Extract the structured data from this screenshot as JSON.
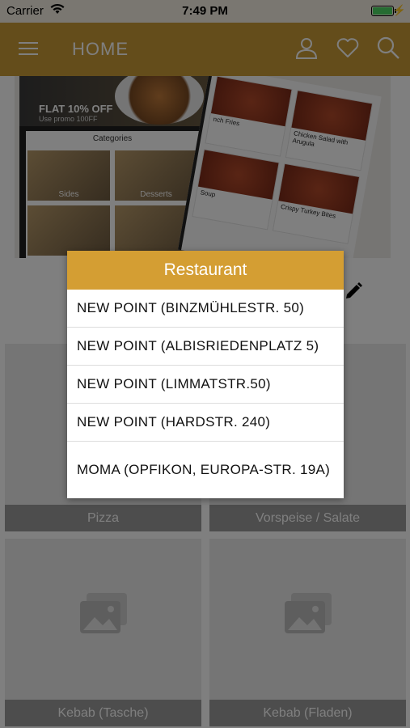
{
  "status_bar": {
    "carrier": "Carrier",
    "time": "7:49 PM"
  },
  "nav": {
    "title": "HOME"
  },
  "banner": {
    "promo_text": "FLAT 10% OFF",
    "promo_code": "Use promo 100FF",
    "categories_title": "Categories",
    "category_labels": [
      "Sides",
      "Desserts",
      "",
      ""
    ],
    "menu_items": [
      "nch Fries",
      "Chicken Salad with Arugula",
      "Soup",
      "Crispy Turkey Bites"
    ]
  },
  "categories": [
    {
      "label": "Pizza"
    },
    {
      "label": "Vorspeise / Salate"
    },
    {
      "label": "Kebab (Tasche)"
    },
    {
      "label": "Kebab (Fladen)"
    }
  ],
  "dialog": {
    "title": "Restaurant",
    "options": [
      "NEW POINT (BINZMÜHLESTR. 50)",
      "NEW POINT (ALBISRIEDENPLATZ 5)",
      "NEW POINT (LIMMATSTR.50)",
      "NEW POINT (HARDSTR. 240)",
      "MOMA (OPFIKON, EUROPA-STR. 19A)"
    ]
  },
  "colors": {
    "accent": "#d49e33",
    "navbar": "#c99a37",
    "caption_bg": "#9a9a9a"
  }
}
